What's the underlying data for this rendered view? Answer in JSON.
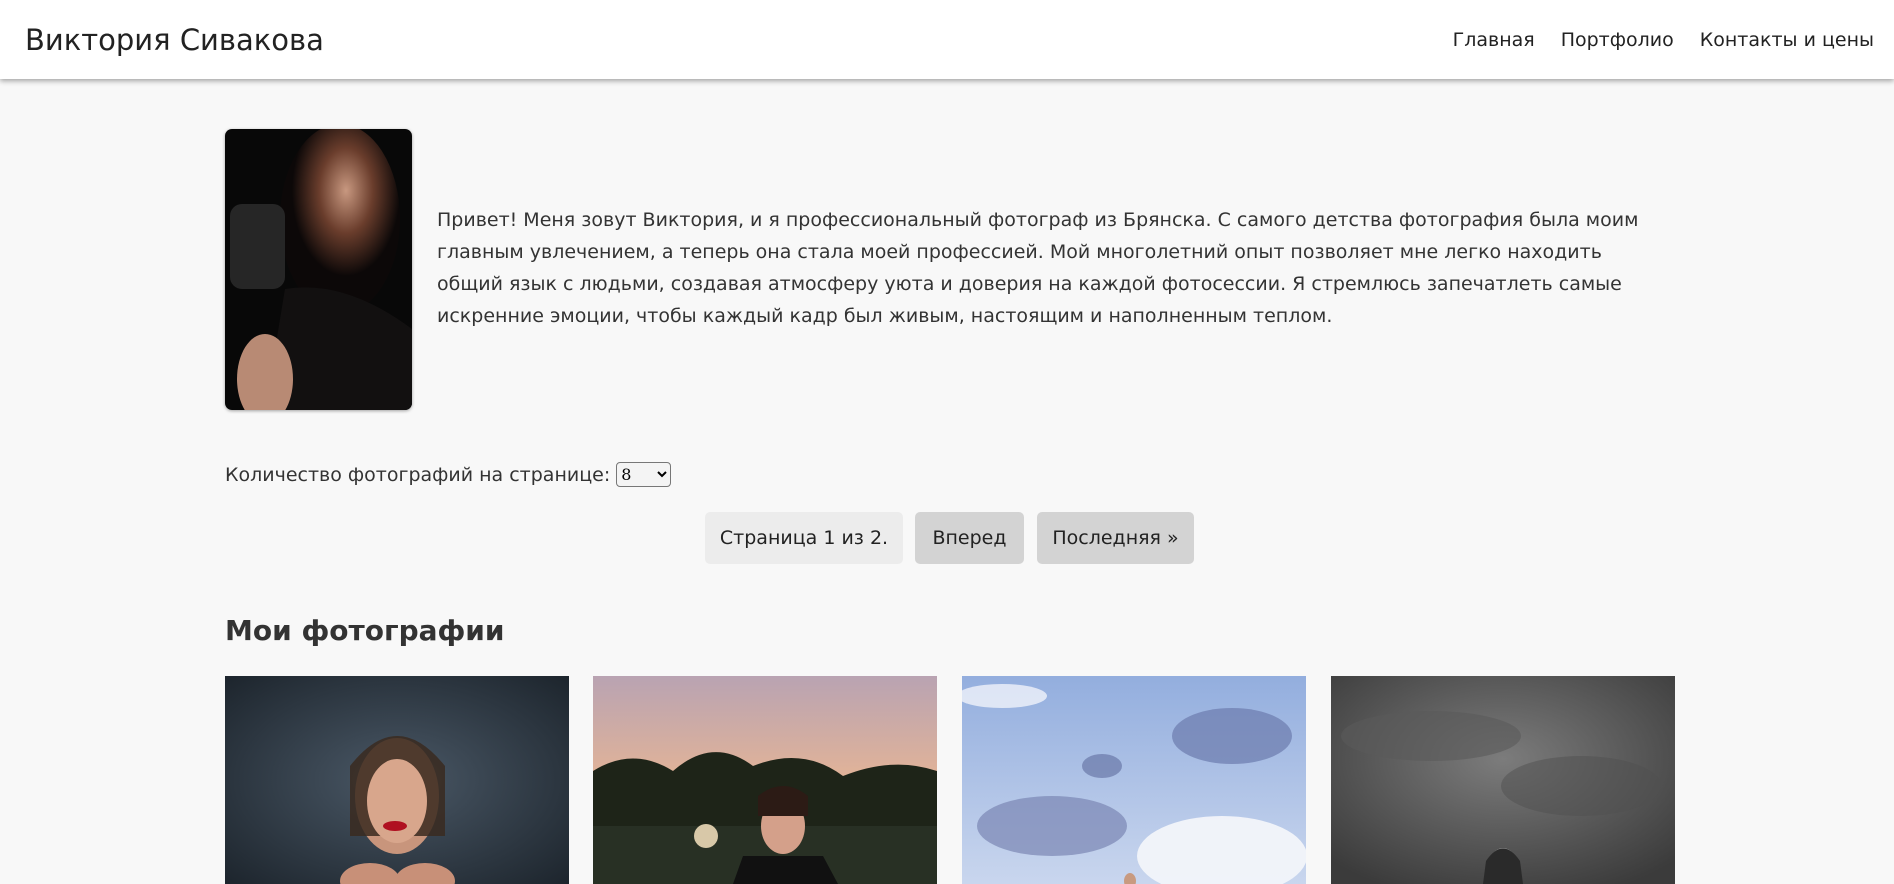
{
  "header": {
    "title": "Виктория Сивакова",
    "nav": [
      "Главная",
      "Портфолио",
      "Контакты и цены"
    ]
  },
  "about": {
    "photo_alt": "portrait-photo",
    "text": "Привет! Меня зовут Виктория, и я профессиональный фотограф из Брянска. С самого детства фотография была моим главным увлечением, а теперь она стала моей профессией. Мой многолетний опыт позволяет мне легко находить общий язык с людьми, создавая атмосферу уюта и доверия на каждой фотосессии. Я стремлюсь запечатлеть самые искренние эмоции, чтобы каждый кадр был живым, настоящим и наполненным теплом."
  },
  "pagination": {
    "per_page_label": "Количество фотографий на странице:",
    "per_page_value": "8",
    "page_info": "Страница 1 из 2.",
    "next_label": "Вперед",
    "last_label": "Последняя »"
  },
  "gallery": {
    "title": "Мои фотографии"
  }
}
